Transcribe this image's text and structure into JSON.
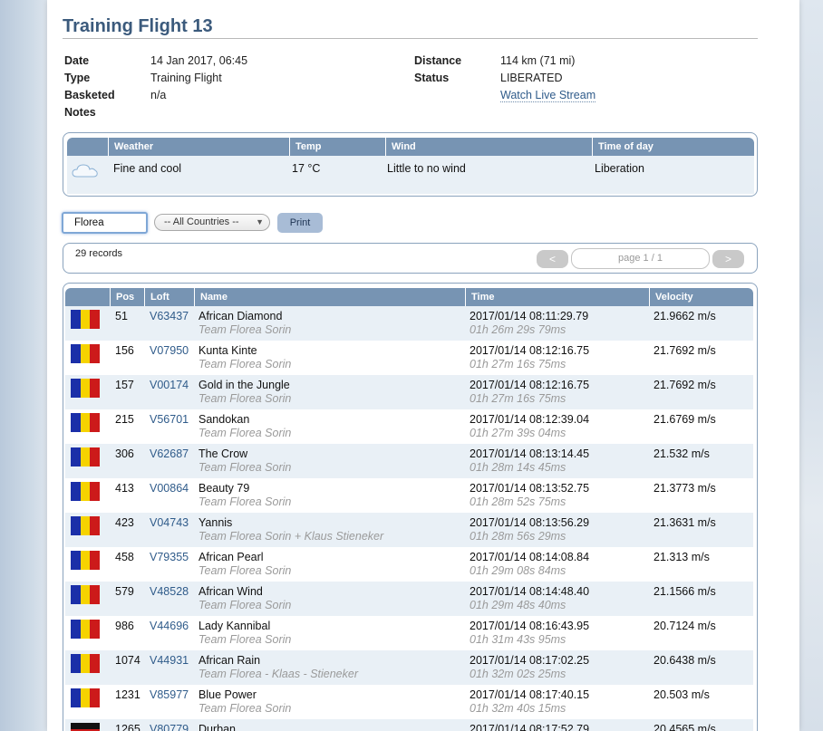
{
  "title": "Training Flight 13",
  "info_left": [
    {
      "label": "Date",
      "value": "14 Jan 2017, 06:45"
    },
    {
      "label": "Type",
      "value": "Training Flight"
    },
    {
      "label": "Basketed",
      "value": "n/a"
    },
    {
      "label": "Notes",
      "value": ""
    }
  ],
  "info_right": {
    "distance_label": "Distance",
    "distance_value": "114 km (71 mi)",
    "status_label": "Status",
    "status_value": "LIBERATED",
    "stream_link": "Watch Live Stream"
  },
  "weather": {
    "headers": [
      "Weather",
      "Temp",
      "Wind",
      "Time of day"
    ],
    "icon": "cloud-icon",
    "values": [
      "Fine and cool",
      "17 °C",
      "Little to no wind",
      "Liberation"
    ]
  },
  "filter": {
    "search_value": "Florea",
    "country_select": "-- All Countries --",
    "print_label": "Print"
  },
  "records_text": "29 records",
  "pager": {
    "prev": "<",
    "page": "page 1 / 1",
    "next": ">"
  },
  "results": {
    "headers": [
      "Pos",
      "Loft",
      "Name",
      "Time",
      "Velocity"
    ],
    "rows": [
      {
        "flag": "RO",
        "pos": "51",
        "loft": "V63437",
        "name": "African Diamond",
        "team": "Team Florea Sorin",
        "time": "2017/01/14 08:11:29.79",
        "duration": "01h 26m 29s 79ms",
        "velocity": "21.9662 m/s"
      },
      {
        "flag": "RO",
        "pos": "156",
        "loft": "V07950",
        "name": "Kunta Kinte",
        "team": "Team Florea Sorin",
        "time": "2017/01/14 08:12:16.75",
        "duration": "01h 27m 16s 75ms",
        "velocity": "21.7692 m/s"
      },
      {
        "flag": "RO",
        "pos": "157",
        "loft": "V00174",
        "name": "Gold in the Jungle",
        "team": "Team Florea Sorin",
        "time": "2017/01/14 08:12:16.75",
        "duration": "01h 27m 16s 75ms",
        "velocity": "21.7692 m/s"
      },
      {
        "flag": "RO",
        "pos": "215",
        "loft": "V56701",
        "name": "Sandokan",
        "team": "Team Florea Sorin",
        "time": "2017/01/14 08:12:39.04",
        "duration": "01h 27m 39s 04ms",
        "velocity": "21.6769 m/s"
      },
      {
        "flag": "RO",
        "pos": "306",
        "loft": "V62687",
        "name": "The Crow",
        "team": "Team Florea Sorin",
        "time": "2017/01/14 08:13:14.45",
        "duration": "01h 28m 14s 45ms",
        "velocity": "21.532 m/s"
      },
      {
        "flag": "RO",
        "pos": "413",
        "loft": "V00864",
        "name": "Beauty 79",
        "team": "Team Florea Sorin",
        "time": "2017/01/14 08:13:52.75",
        "duration": "01h 28m 52s 75ms",
        "velocity": "21.3773 m/s"
      },
      {
        "flag": "RO",
        "pos": "423",
        "loft": "V04743",
        "name": "Yannis",
        "team": "Team Florea Sorin + Klaus Stieneker",
        "time": "2017/01/14 08:13:56.29",
        "duration": "01h 28m 56s 29ms",
        "velocity": "21.3631 m/s"
      },
      {
        "flag": "RO",
        "pos": "458",
        "loft": "V79355",
        "name": "African Pearl",
        "team": "Team Florea Sorin",
        "time": "2017/01/14 08:14:08.84",
        "duration": "01h 29m 08s 84ms",
        "velocity": "21.313 m/s"
      },
      {
        "flag": "RO",
        "pos": "579",
        "loft": "V48528",
        "name": "African Wind",
        "team": "Team Florea Sorin",
        "time": "2017/01/14 08:14:48.40",
        "duration": "01h 29m 48s 40ms",
        "velocity": "21.1566 m/s"
      },
      {
        "flag": "RO",
        "pos": "986",
        "loft": "V44696",
        "name": "Lady Kannibal",
        "team": "Team Florea Sorin",
        "time": "2017/01/14 08:16:43.95",
        "duration": "01h 31m 43s 95ms",
        "velocity": "20.7124 m/s"
      },
      {
        "flag": "RO",
        "pos": "1074",
        "loft": "V44931",
        "name": "African Rain",
        "team": "Team Florea - Klaas - Stieneker",
        "time": "2017/01/14 08:17:02.25",
        "duration": "01h 32m 02s 25ms",
        "velocity": "20.6438 m/s"
      },
      {
        "flag": "RO",
        "pos": "1231",
        "loft": "V85977",
        "name": "Blue Power",
        "team": "Team Florea Sorin",
        "time": "2017/01/14 08:17:40.15",
        "duration": "01h 32m 40s 15ms",
        "velocity": "20.503 m/s"
      },
      {
        "flag": "DE",
        "pos": "1265",
        "loft": "V80779",
        "name": "Durban",
        "team": "",
        "time": "2017/01/14 08:17:52.79",
        "duration": "",
        "velocity": "20.4565 m/s"
      }
    ]
  },
  "colors": {
    "accent": "#3b5a7c",
    "header_bar": "#7794b3",
    "row_alt": "#e9f0f6",
    "link": "#2f5b8a"
  }
}
